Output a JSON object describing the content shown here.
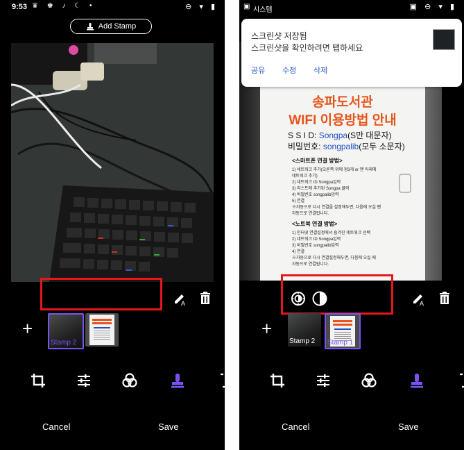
{
  "left": {
    "status": {
      "time": "9:53"
    },
    "stamp_button": {
      "label": "Add Stamp"
    },
    "thumbs": [
      {
        "label": "Stamp 2"
      },
      {
        "label": ""
      }
    ],
    "actions": {
      "cancel": "Cancel",
      "save": "Save"
    }
  },
  "right": {
    "sysbar": {
      "label": "시스템"
    },
    "notification": {
      "title": "스크린샷 저장됨",
      "text": "스크린샷을 확인하려면 탭하세요",
      "actions": [
        "공유",
        "수정",
        "삭제"
      ]
    },
    "poster": {
      "title1": "송파도서관",
      "title2": "WIFI 이용방법 안내",
      "ssid_label": "S S I D:",
      "ssid_value": "Songpa",
      "ssid_note": "(S만 대문자)",
      "pw_label": "비밀번호:",
      "pw_value": "songpalib",
      "pw_note": "(모두 소문자)",
      "smart_title": "<스마트폰 연결 방법>",
      "smart_lines": [
        "1)  네트워크 추가(오른쪽 위에 점3개 or 맨 아래에",
        "     네트워크 추기)",
        "2)  네트워크 ID Songpa입력",
        "3)  리스트에 추가된 Songpa 클릭",
        "4)  비밀번호 songpalib입력",
        "5)  연결",
        "※자동으로 다시 연결을 설정해두면, 다음에 오실 땐",
        "   자동으로 연결됩니다."
      ],
      "note_title": "<노트북 연결 방법>",
      "note_lines": [
        "1)  인터넷 연결설정에서 숨겨진 네트워크 선택",
        "2)  네트워크 ID Songpa입력",
        "3)  비밀번호 songpalib입력",
        "4)  연결",
        "※자동으로 다시 연결설정해두면, 다음에 오실 때",
        "   자동으로 연결됩니다."
      ]
    },
    "thumbs": [
      {
        "label": "Stamp 2"
      },
      {
        "label": "Stamp 1"
      }
    ],
    "actions": {
      "cancel": "Cancel",
      "save": "Save"
    }
  },
  "colors": {
    "accent": "#7a52f4",
    "highlight": "#e8151b",
    "link": "#2a56c6",
    "poster_title": "#e8551c"
  },
  "icons": [
    "stamp-icon",
    "edit-text-icon",
    "delete-icon",
    "add-icon",
    "crop-rotate-icon",
    "adjust-icon",
    "filter-icon",
    "stamp-tool-icon",
    "brightness-icon",
    "contrast-icon"
  ]
}
